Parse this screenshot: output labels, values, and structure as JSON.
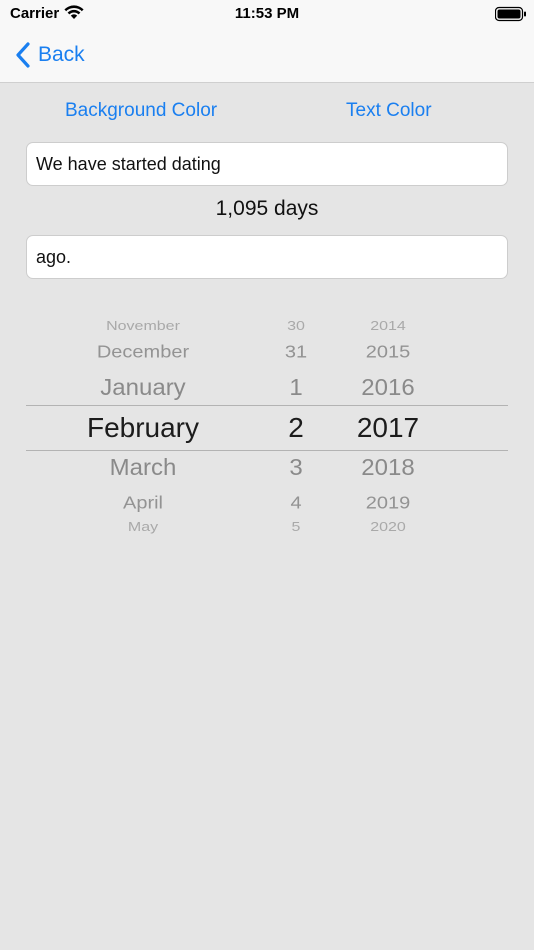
{
  "status_bar": {
    "carrier": "Carrier",
    "time": "11:53 PM"
  },
  "nav": {
    "back_label": "Back"
  },
  "toolbar": {
    "background_color_label": "Background Color",
    "text_color_label": "Text Color"
  },
  "prefix_text": "We have started dating",
  "days_text": "1,095 days",
  "suffix_text": "ago.",
  "date_picker": {
    "months": [
      "November",
      "December",
      "January",
      "February",
      "March",
      "April",
      "May"
    ],
    "days": [
      "30",
      "31",
      "1",
      "2",
      "3",
      "4",
      "5"
    ],
    "years": [
      "2014",
      "2015",
      "2016",
      "2017",
      "2018",
      "2019",
      "2020"
    ],
    "selected": {
      "month": "February",
      "day": "2",
      "year": "2017"
    }
  },
  "colors": {
    "accent": "#1a7ff0",
    "background": "#e5e5e5"
  }
}
